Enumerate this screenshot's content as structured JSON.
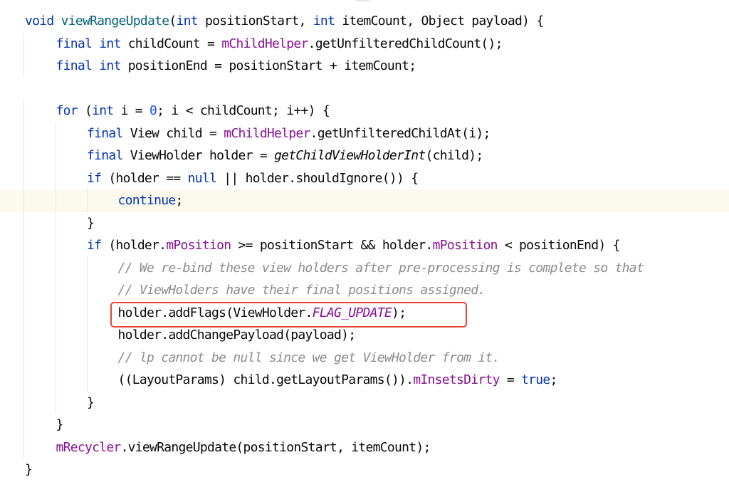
{
  "editor": {
    "highlight_color": "#e5433a",
    "current_line_index": 8,
    "highlighted_line_index": 13,
    "lines": [
      {
        "indent": 0,
        "tokens": [
          {
            "t": "void",
            "c": "kw"
          },
          {
            "t": " ",
            "c": "plain"
          },
          {
            "t": "viewRangeUpdate",
            "c": "method"
          },
          {
            "t": "(",
            "c": "plain"
          },
          {
            "t": "int",
            "c": "kw"
          },
          {
            "t": " positionStart, ",
            "c": "plain"
          },
          {
            "t": "int",
            "c": "kw"
          },
          {
            "t": " itemCount, Object payload) {",
            "c": "plain"
          }
        ]
      },
      {
        "indent": 1,
        "tokens": [
          {
            "t": "final",
            "c": "kw"
          },
          {
            "t": " ",
            "c": "plain"
          },
          {
            "t": "int",
            "c": "kw"
          },
          {
            "t": " childCount = ",
            "c": "plain"
          },
          {
            "t": "mChildHelper",
            "c": "field"
          },
          {
            "t": ".getUnfilteredChildCount();",
            "c": "plain"
          }
        ]
      },
      {
        "indent": 1,
        "tokens": [
          {
            "t": "final",
            "c": "kw"
          },
          {
            "t": " ",
            "c": "plain"
          },
          {
            "t": "int",
            "c": "kw"
          },
          {
            "t": " positionEnd = positionStart + itemCount;",
            "c": "plain"
          }
        ]
      },
      {
        "indent": 0,
        "tokens": []
      },
      {
        "indent": 1,
        "tokens": [
          {
            "t": "for",
            "c": "kw"
          },
          {
            "t": " (",
            "c": "plain"
          },
          {
            "t": "int",
            "c": "kw"
          },
          {
            "t": " i = ",
            "c": "plain"
          },
          {
            "t": "0",
            "c": "num"
          },
          {
            "t": "; i < childCount; i++) {",
            "c": "plain"
          }
        ]
      },
      {
        "indent": 2,
        "tokens": [
          {
            "t": "final",
            "c": "kw"
          },
          {
            "t": " View child = ",
            "c": "plain"
          },
          {
            "t": "mChildHelper",
            "c": "field"
          },
          {
            "t": ".getUnfilteredChildAt(i);",
            "c": "plain"
          }
        ]
      },
      {
        "indent": 2,
        "tokens": [
          {
            "t": "final",
            "c": "kw"
          },
          {
            "t": " ViewHolder holder = ",
            "c": "plain"
          },
          {
            "t": "getChildViewHolderInt",
            "c": "italic"
          },
          {
            "t": "(child);",
            "c": "plain"
          }
        ]
      },
      {
        "indent": 2,
        "tokens": [
          {
            "t": "if",
            "c": "kw"
          },
          {
            "t": " (holder == ",
            "c": "plain"
          },
          {
            "t": "null",
            "c": "kw"
          },
          {
            "t": " || holder.shouldIgnore()) {",
            "c": "plain"
          }
        ]
      },
      {
        "indent": 3,
        "tokens": [
          {
            "t": "continue",
            "c": "kw"
          },
          {
            "t": ";",
            "c": "plain"
          }
        ]
      },
      {
        "indent": 2,
        "tokens": [
          {
            "t": "}",
            "c": "plain"
          }
        ]
      },
      {
        "indent": 2,
        "tokens": [
          {
            "t": "if",
            "c": "kw"
          },
          {
            "t": " (holder.",
            "c": "plain"
          },
          {
            "t": "mPosition",
            "c": "field"
          },
          {
            "t": " >= positionStart && holder.",
            "c": "plain"
          },
          {
            "t": "mPosition",
            "c": "field"
          },
          {
            "t": " < positionEnd) {",
            "c": "plain"
          }
        ]
      },
      {
        "indent": 3,
        "tokens": [
          {
            "t": "// We re-bind these view holders after pre-processing is complete so that",
            "c": "comment"
          }
        ]
      },
      {
        "indent": 3,
        "tokens": [
          {
            "t": "// ViewHolders have their final positions assigned.",
            "c": "comment"
          }
        ]
      },
      {
        "indent": 3,
        "tokens": [
          {
            "t": "holder.addFlags(ViewHolder.",
            "c": "plain"
          },
          {
            "t": "FLAG_UPDATE",
            "c": "static"
          },
          {
            "t": ");",
            "c": "plain"
          }
        ]
      },
      {
        "indent": 3,
        "tokens": [
          {
            "t": "holder.addChangePayload(payload);",
            "c": "plain"
          }
        ]
      },
      {
        "indent": 3,
        "tokens": [
          {
            "t": "// lp cannot be null since we get ViewHolder from it.",
            "c": "comment"
          }
        ]
      },
      {
        "indent": 3,
        "tokens": [
          {
            "t": "((LayoutParams) child.getLayoutParams()).",
            "c": "plain"
          },
          {
            "t": "mInsetsDirty",
            "c": "field"
          },
          {
            "t": " = ",
            "c": "plain"
          },
          {
            "t": "true",
            "c": "kw"
          },
          {
            "t": ";",
            "c": "plain"
          }
        ]
      },
      {
        "indent": 2,
        "tokens": [
          {
            "t": "}",
            "c": "plain"
          }
        ]
      },
      {
        "indent": 1,
        "tokens": [
          {
            "t": "}",
            "c": "plain"
          }
        ]
      },
      {
        "indent": 1,
        "tokens": [
          {
            "t": "mRecycler",
            "c": "field"
          },
          {
            "t": ".viewRangeUpdate(positionStart, itemCount);",
            "c": "plain"
          }
        ]
      },
      {
        "indent": 0,
        "tokens": [
          {
            "t": "}",
            "c": "plain"
          }
        ]
      }
    ]
  }
}
